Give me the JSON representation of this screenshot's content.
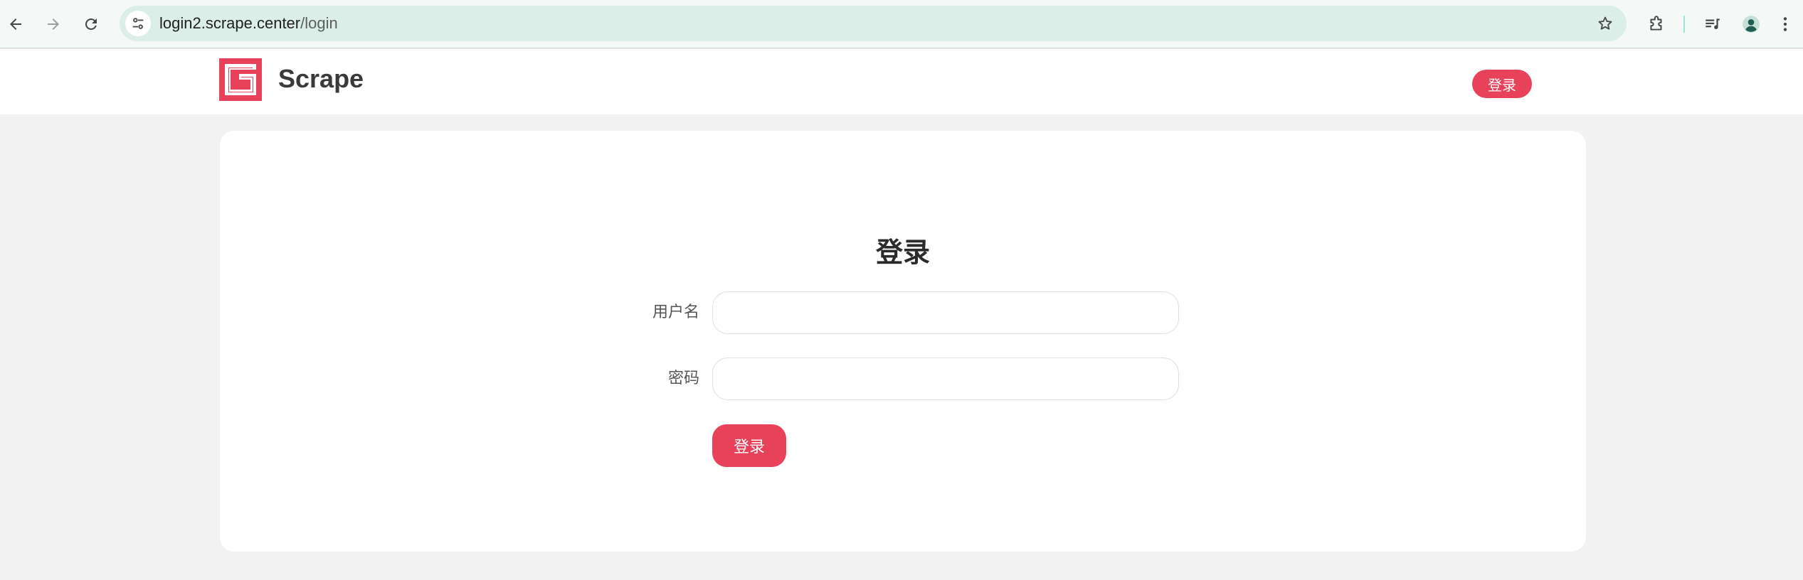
{
  "browser": {
    "url_host": "login2.scrape.center",
    "url_path": "/login"
  },
  "header": {
    "brand": "Scrape",
    "login_label": "登录",
    "accent_color": "#e8425a"
  },
  "login_form": {
    "title": "登录",
    "username_label": "用户名",
    "username_value": "",
    "password_label": "密码",
    "password_value": "",
    "submit_label": "登录"
  },
  "icons": {
    "back": "back-arrow-icon",
    "forward": "forward-arrow-icon",
    "reload": "reload-icon",
    "site_info": "tune-icon",
    "bookmark": "star-icon",
    "extensions": "puzzle-icon",
    "media": "media-queue-icon",
    "profile": "profile-avatar-icon",
    "menu": "kebab-menu-icon"
  }
}
